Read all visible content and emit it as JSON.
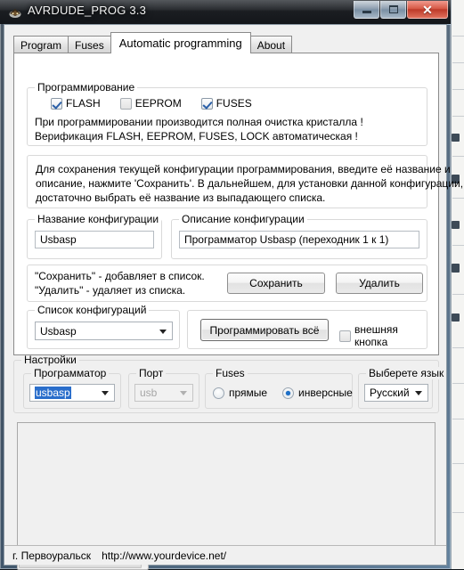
{
  "window": {
    "title": "AVRDUDE_PROG 3.3",
    "icon": "app-icon",
    "buttons": {
      "minimize": "minimize",
      "maximize": "maximize",
      "close": "✕"
    }
  },
  "tabs": [
    {
      "label": "Program",
      "active": false
    },
    {
      "label": "Fuses",
      "active": false
    },
    {
      "label": "Automatic programming",
      "active": true
    },
    {
      "label": "About",
      "active": false
    }
  ],
  "programming_group": {
    "title": "Программирование",
    "checkboxes": [
      {
        "label": "FLASH",
        "checked": true
      },
      {
        "label": "EEPROM",
        "checked": false
      },
      {
        "label": "FUSES",
        "checked": true
      }
    ],
    "note_line1": "При программировании производится полная очистка кристалла !",
    "note_line2": "Верификация FLASH, EEPROM, FUSES, LOCK автоматическая !"
  },
  "help_panel": {
    "line1": "Для сохранения текущей конфигурации программирования, введите её название и",
    "line2": "описание, нажмите 'Сохранить'. В дальнейшем, для установки данной конфигурации,",
    "line3": "достаточно выбрать её название из выпадающего списка."
  },
  "config_name_group": {
    "title": "Название конфигурации",
    "value": "Usbasp",
    "placeholder": ""
  },
  "config_desc_group": {
    "title": "Описание конфигурации",
    "value": "Программатор Usbasp  (переходник 1 к 1)",
    "placeholder": ""
  },
  "hints": {
    "save_hint": "\"Сохранить\" - добавляет в список.",
    "delete_hint": "\"Удалить\" - удаляет из списка."
  },
  "actions": {
    "save_label": "Сохранить",
    "delete_label": "Удалить",
    "program_all_label": "Программировать всё",
    "external_button_label": "внешняя кнопка",
    "external_button_checked": false
  },
  "config_list_group": {
    "title": "Список конфигураций",
    "selected": "Usbasp",
    "options": [
      "Usbasp"
    ]
  },
  "settings": {
    "title": "Настройки",
    "programmer": {
      "title": "Программатор",
      "selected": "usbasp",
      "options": [
        "usbasp"
      ]
    },
    "port": {
      "title": "Порт",
      "selected": "usb",
      "options": [
        "usb"
      ],
      "disabled": true
    },
    "fuses": {
      "title": "Fuses",
      "options": [
        {
          "label": "прямые",
          "selected": false
        },
        {
          "label": "инверсные",
          "selected": true
        }
      ]
    },
    "language": {
      "title": "Выберете язык",
      "selected": "Русский",
      "options": [
        "Русский"
      ]
    }
  },
  "log": {
    "content": ""
  },
  "progress": {
    "value": 0,
    "fill_percent": 96
  },
  "statusbar": {
    "city": "г. Первоуральск",
    "url": "http://www.yourdevice.net/"
  },
  "colors": {
    "accent": "#2a6ecb",
    "close_button": "#bd3a29",
    "window_bg": "#f0f0f0"
  }
}
